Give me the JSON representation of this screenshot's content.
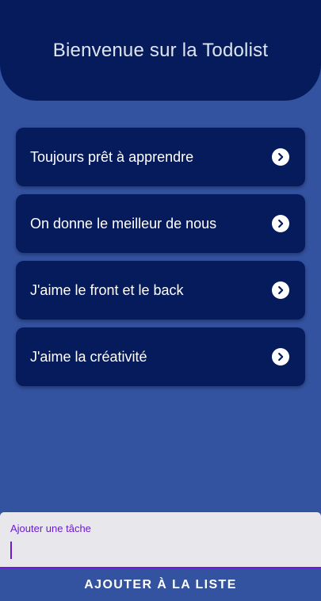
{
  "header": {
    "title": "Bienvenue sur la Todolist"
  },
  "tasks": [
    {
      "label": "Toujours prêt à apprendre",
      "icon": "chevron-right-circle-icon"
    },
    {
      "label": "On donne le meilleur de nous",
      "icon": "chevron-right-circle-icon"
    },
    {
      "label": "J'aime le front et le back",
      "icon": "chevron-right-circle-icon"
    },
    {
      "label": "J'aime la créativité",
      "icon": "chevron-right-circle-icon"
    }
  ],
  "input": {
    "label": "Ajouter une tâche",
    "value": ""
  },
  "add_button": {
    "label": "AJOUTER À LA LISTE"
  },
  "colors": {
    "background": "#3352a0",
    "card": "#061b5c",
    "accent": "#6a1bd1"
  }
}
